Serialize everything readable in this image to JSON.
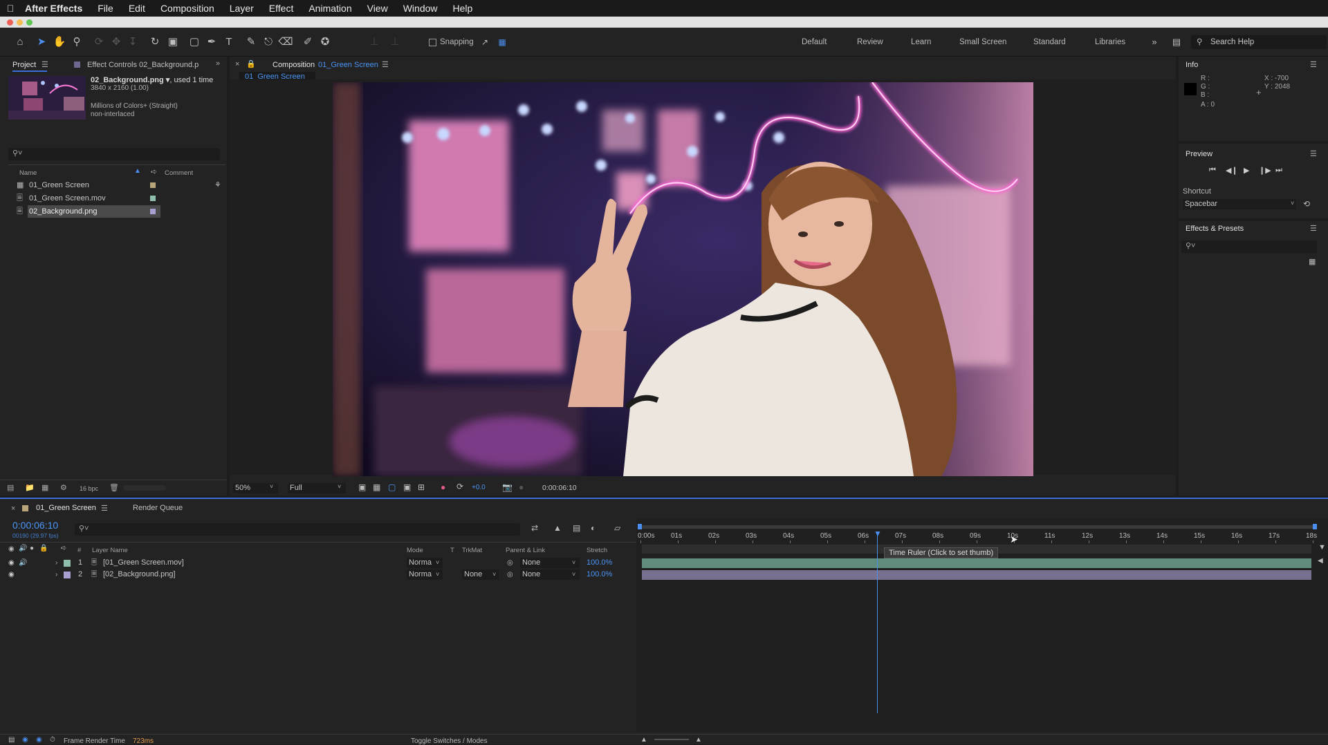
{
  "menubar": {
    "app_name": "After Effects",
    "items": [
      "File",
      "Edit",
      "Composition",
      "Layer",
      "Effect",
      "Animation",
      "View",
      "Window",
      "Help"
    ]
  },
  "toolbar": {
    "snapping_label": "Snapping",
    "workspaces": [
      "Default",
      "Review",
      "Learn",
      "Small Screen",
      "Standard",
      "Libraries"
    ],
    "search_placeholder": "Search Help"
  },
  "project_panel": {
    "tab_project": "Project",
    "tab_effect_controls": "Effect Controls 02_Background.p",
    "selected_file": "02_Background.png ▾",
    "used_times": ", used 1 time",
    "dimensions": "3840 x 2160 (1.00)",
    "color_info": "Millions of Colors+ (Straight)",
    "interlace": "non-interlaced",
    "col_name": "Name",
    "col_comment": "Comment",
    "items": [
      {
        "name": "01_Green Screen",
        "color": "#b8a57a"
      },
      {
        "name": "01_Green Screen.mov",
        "color": "#8fbfaa"
      },
      {
        "name": "02_Background.png",
        "color": "#a8a0d0"
      }
    ],
    "bpc": "16 bpc"
  },
  "composition_panel": {
    "tab_prefix": "Composition",
    "tab_name": "01_Green Screen",
    "sub_tab": "01_Green Screen",
    "zoom": "50%",
    "resolution": "Full",
    "exposure": "+0.0",
    "timecode": "0:00:06:10"
  },
  "info_panel": {
    "title": "Info",
    "r": "R :",
    "g": "G :",
    "b": "B :",
    "a": "A :  0",
    "x": "X : -700",
    "y": "Y : 2048"
  },
  "preview_panel": {
    "title": "Preview",
    "shortcut_label": "Shortcut",
    "shortcut_value": "Spacebar"
  },
  "effects_panel": {
    "title": "Effects & Presets"
  },
  "timeline": {
    "tab_comp": "01_Green Screen",
    "tab_render": "Render Queue",
    "current_time": "0:00:06:10",
    "frame_info": "00190 (29.97 fps)",
    "col_layer_name": "Layer Name",
    "col_mode": "Mode",
    "col_t": "T",
    "col_trkmat": "TrkMat",
    "col_parent": "Parent & Link",
    "col_stretch": "Stretch",
    "ruler": [
      "0:00s",
      "01s",
      "02s",
      "03s",
      "04s",
      "05s",
      "06s",
      "07s",
      "08s",
      "09s",
      "10s",
      "11s",
      "12s",
      "13s",
      "14s",
      "15s",
      "16s",
      "17s",
      "18s"
    ],
    "layers": [
      {
        "num": "1",
        "name": "[01_Green Screen.mov]",
        "mode": "Norma",
        "trkmat": "",
        "parent": "None",
        "stretch": "100.0%",
        "color": "#8fbfaa",
        "bar": "#5f8c7c"
      },
      {
        "num": "2",
        "name": "[02_Background.png]",
        "mode": "Norma",
        "trkmat": "None",
        "parent": "None",
        "stretch": "100.0%",
        "color": "#a8a0d0",
        "bar": "#77708f"
      }
    ],
    "tooltip": "Time Ruler (Click to set thumb)",
    "frame_render_label": "Frame Render Time",
    "frame_render_value": "723ms",
    "toggle_label": "Toggle Switches / Modes"
  }
}
